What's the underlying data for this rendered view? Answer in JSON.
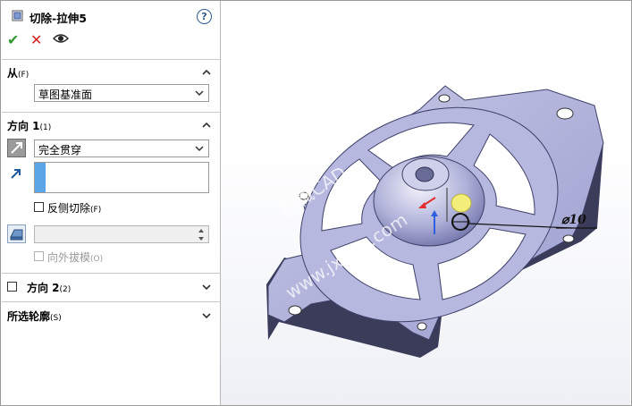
{
  "panel": {
    "title": "切除-拉伸5",
    "help": "?",
    "actions": {
      "ok": "✔",
      "cancel": "✕"
    }
  },
  "from": {
    "title": "从",
    "shortcut": "(F)",
    "value": "草图基准面"
  },
  "direction1": {
    "title": "方向 1",
    "shortcut": "(1)",
    "end_condition": "完全贯穿",
    "flip_cut": {
      "label": "反侧切除",
      "shortcut": "(F)",
      "checked": false
    },
    "draft_outward": {
      "label": "向外拔模",
      "shortcut": "(O)",
      "checked": false
    }
  },
  "direction2": {
    "title": "方向 2",
    "shortcut": "(2)",
    "checked": false
  },
  "selected_contours": {
    "title": "所选轮廓",
    "shortcut": "(S)"
  },
  "viewport": {
    "dimension_label": "⌀10",
    "watermark_1": "机械CAD",
    "watermark_2": "www.jxage.com",
    "colors": {
      "part": "#a6a8d6",
      "accent_yellow": "#f3ee7a",
      "axis_red": "#e03030",
      "axis_blue": "#2f5fe0"
    }
  }
}
